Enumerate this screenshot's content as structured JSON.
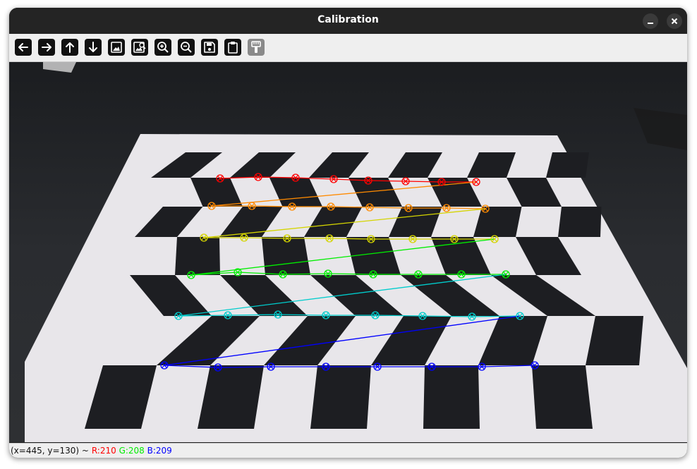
{
  "window": {
    "title": "Calibration"
  },
  "window_controls": {
    "minimize": "minimize-icon",
    "close": "close-icon"
  },
  "toolbar": {
    "buttons": [
      {
        "icon": "arrow-left-icon",
        "enabled": true
      },
      {
        "icon": "arrow-right-icon",
        "enabled": true
      },
      {
        "icon": "arrow-up-icon",
        "enabled": true
      },
      {
        "icon": "arrow-down-icon",
        "enabled": true
      },
      {
        "icon": "image-icon",
        "enabled": true
      },
      {
        "icon": "image-zoom-icon",
        "enabled": true
      },
      {
        "icon": "zoom-in-icon",
        "enabled": true
      },
      {
        "icon": "zoom-out-icon",
        "enabled": true
      },
      {
        "icon": "save-icon",
        "enabled": true
      },
      {
        "icon": "clipboard-icon",
        "enabled": true
      },
      {
        "icon": "brush-icon",
        "enabled": false
      }
    ]
  },
  "status": {
    "coords": "(x=445, y=130) ~",
    "r": "R:210",
    "g": "G:208",
    "b": "B:209",
    "r_color": "#ff0000",
    "g_color": "#00ee00",
    "b_color": "#0000ff"
  },
  "calibration": {
    "row_colors": [
      "#ff0000",
      "#ff8a00",
      "#d4d400",
      "#00ee00",
      "#00cccc",
      "#0000ff"
    ],
    "marker": "circle-x"
  }
}
